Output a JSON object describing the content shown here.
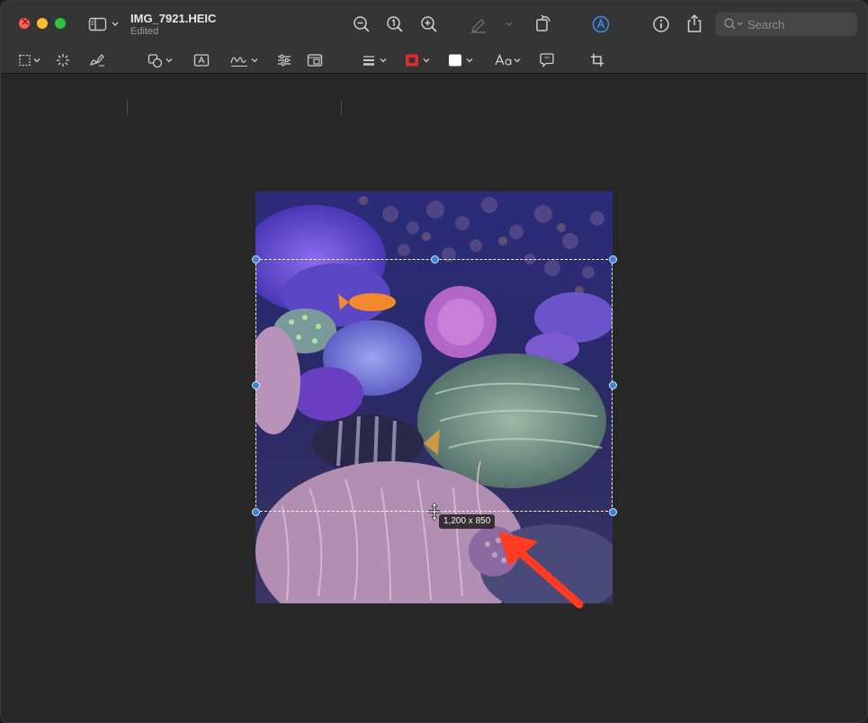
{
  "window": {
    "title": "IMG_7921.HEIC",
    "subtitle": "Edited"
  },
  "search": {
    "placeholder": "Search"
  },
  "selection": {
    "size_label": "1,200 x 850"
  },
  "colors": {
    "accent": "#3b82d9",
    "annotation_arrow": "#ff3b22",
    "toolbar_bg": "#353535",
    "canvas_bg": "#272727"
  },
  "icons": {
    "titlebar": [
      "sidebar-icon",
      "zoom-out-icon",
      "actual-size-icon",
      "zoom-in-icon",
      "highlight-icon",
      "rotate-icon",
      "markup-icon",
      "info-icon",
      "share-icon",
      "search-icon"
    ],
    "markup_toolbar": [
      "rectangular-selection-icon",
      "instant-alpha-icon",
      "sketch-icon",
      "shapes-icon",
      "text-box-icon",
      "signature-icon",
      "adjust-color-icon",
      "adjust-size-icon",
      "shape-style-icon",
      "border-color-icon",
      "fill-color-icon",
      "text-style-icon",
      "note-icon",
      "crop-icon"
    ]
  }
}
